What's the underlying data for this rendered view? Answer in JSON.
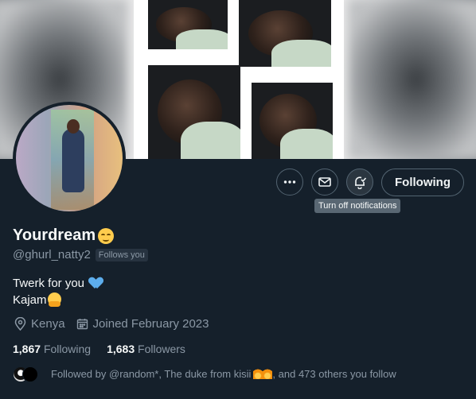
{
  "profile": {
    "name": "Yourdream",
    "handle": "@ghurl_natty2",
    "follows_you": "Follows you",
    "bio_line1": "Twerk for you",
    "bio_line2": "Kajam",
    "location": "Kenya",
    "joined": "Joined February 2023"
  },
  "actions": {
    "following_label": "Following",
    "notif_tooltip": "Turn off notifications"
  },
  "stats": {
    "following_count": "1,867",
    "following_label": "Following",
    "followers_count": "1,683",
    "followers_label": "Followers"
  },
  "followed_by": {
    "prefix": "Followed by ",
    "names": "@random*, The duke from kisii",
    "suffix": ", and 473 others you follow"
  },
  "colors": {
    "background": "#15202b",
    "secondary_text": "#8b98a5",
    "border": "#536471"
  },
  "icons": [
    "more-icon",
    "mail-icon",
    "bell-check-icon",
    "location-icon",
    "calendar-icon"
  ]
}
